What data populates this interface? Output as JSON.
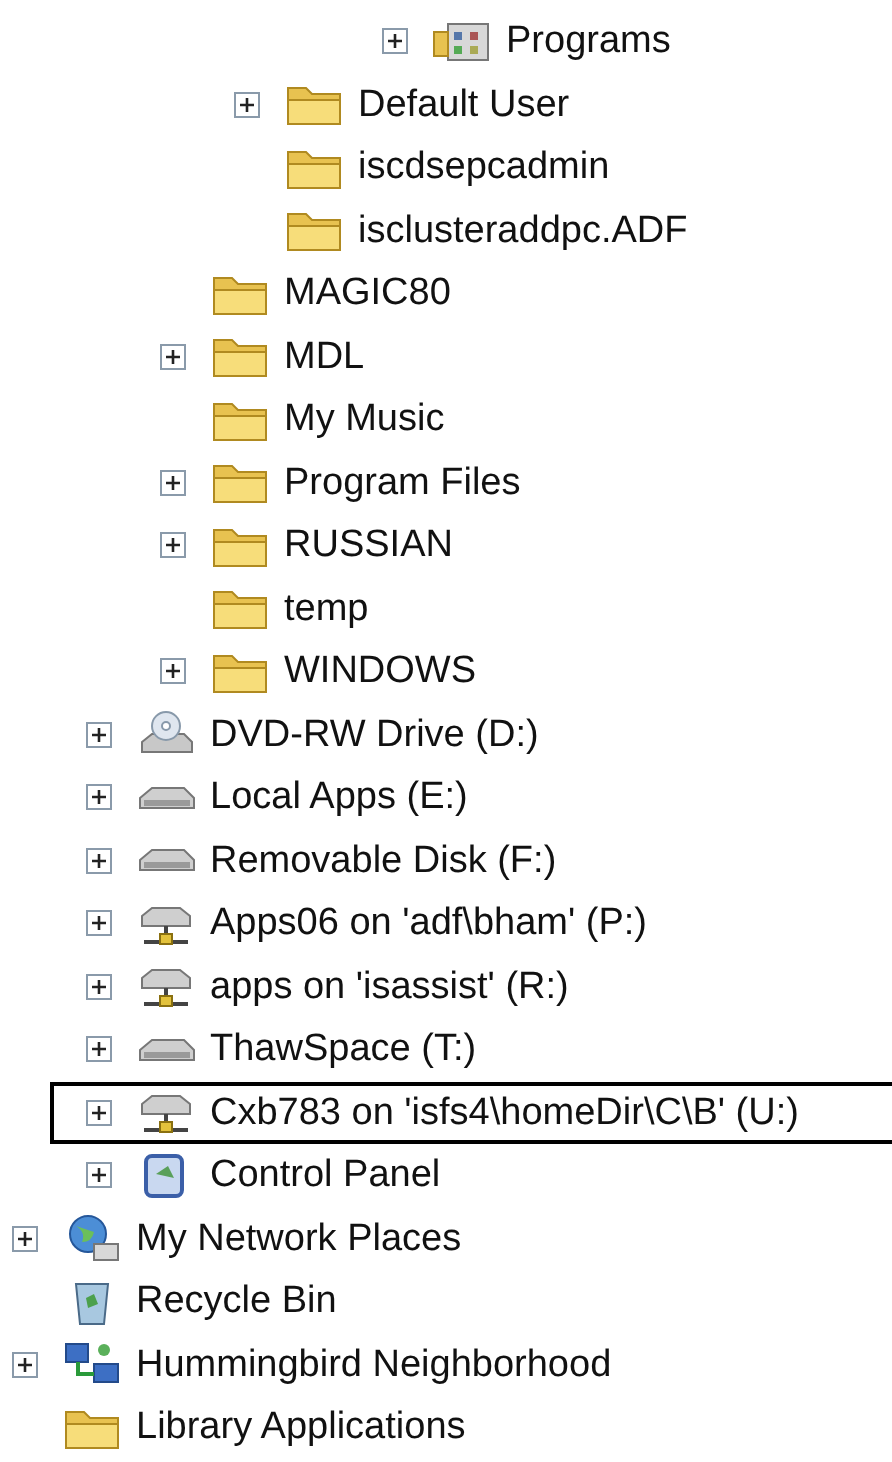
{
  "tree": [
    {
      "children": [
        {
          "children": [
            {
              "children": [
                {
                  "children": [
                    {
                      "children": [
                        {
                          "label": "Programs",
                          "kind": "programs",
                          "expandable": true,
                          "selected": false
                        }
                      ]
                    }
                  ]
                },
                {
                  "label": "Default User",
                  "kind": "folder",
                  "expandable": true,
                  "selected": false
                },
                {
                  "label": "iscdsepcadmin",
                  "kind": "folder",
                  "expandable": false,
                  "selected": false
                },
                {
                  "label": "isclusteraddpc.ADF",
                  "kind": "folder",
                  "expandable": false,
                  "selected": false
                }
              ]
            },
            {
              "label": "MAGIC80",
              "kind": "folder",
              "expandable": false,
              "selected": false
            },
            {
              "label": "MDL",
              "kind": "folder",
              "expandable": true,
              "selected": false
            },
            {
              "label": "My Music",
              "kind": "folder",
              "expandable": false,
              "selected": false
            },
            {
              "label": "Program Files",
              "kind": "folder",
              "expandable": true,
              "selected": false
            },
            {
              "label": "RUSSIAN",
              "kind": "folder",
              "expandable": true,
              "selected": false
            },
            {
              "label": "temp",
              "kind": "folder",
              "expandable": false,
              "selected": false
            },
            {
              "label": "WINDOWS",
              "kind": "folder",
              "expandable": true,
              "selected": false
            }
          ]
        },
        {
          "label": "DVD-RW Drive (D:)",
          "kind": "dvd",
          "expandable": true,
          "selected": false
        },
        {
          "label": "Local Apps (E:)",
          "kind": "drive",
          "expandable": true,
          "selected": false
        },
        {
          "label": "Removable Disk (F:)",
          "kind": "drive",
          "expandable": true,
          "selected": false
        },
        {
          "label": "Apps06 on 'adf\\bham' (P:)",
          "kind": "network-drive",
          "expandable": true,
          "selected": false
        },
        {
          "label": "apps on 'isassist' (R:)",
          "kind": "network-drive",
          "expandable": true,
          "selected": false
        },
        {
          "label": "ThawSpace (T:)",
          "kind": "drive",
          "expandable": true,
          "selected": false
        },
        {
          "label": "Cxb783 on 'isfs4\\homeDir\\C\\B' (U:)",
          "kind": "network-drive",
          "expandable": true,
          "selected": true
        },
        {
          "label": "Control Panel",
          "kind": "control-panel",
          "expandable": true,
          "selected": false
        }
      ]
    },
    {
      "label": "My Network Places",
      "kind": "network",
      "expandable": true,
      "selected": false
    },
    {
      "label": "Recycle Bin",
      "kind": "recycle-bin",
      "expandable": false,
      "selected": false
    },
    {
      "label": "Hummingbird Neighborhood",
      "kind": "hummingbird",
      "expandable": true,
      "selected": false
    },
    {
      "label": "Library Applications",
      "kind": "folder",
      "expandable": false,
      "selected": false
    }
  ]
}
